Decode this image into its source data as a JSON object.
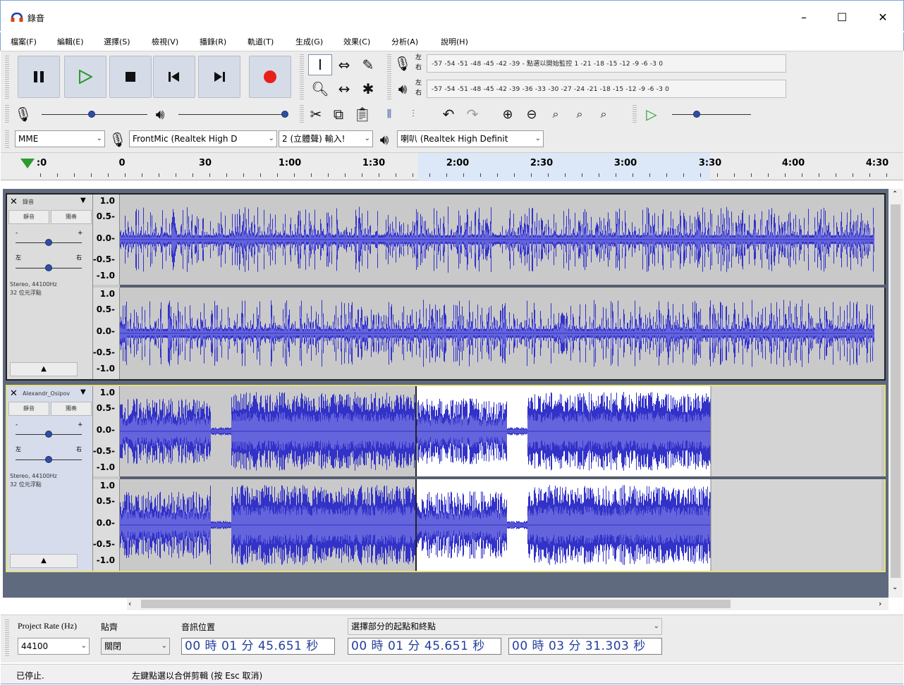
{
  "window": {
    "title": "錄音",
    "minimize": "–",
    "maximize": "☐",
    "close": "✕"
  },
  "menu": [
    "檔案(F)",
    "編輯(E)",
    "選擇(S)",
    "檢視(V)",
    "播錄(R)",
    "軌道(T)",
    "生成(G)",
    "效果(C)",
    "分析(A)",
    "說明(H)"
  ],
  "meters": {
    "record_lr": "左\n右",
    "play_lr": "左\n右",
    "record_scale": "-57 -54 -51 -48 -45 -42 -39 - 點選以開始監控 1 -21 -18 -15 -12 -9 -6 -3 0",
    "play_scale": "-57 -54 -51 -48 -45 -42 -39 -36 -33 -30 -27 -24 -21 -18 -15 -12 -9 -6 -3 0"
  },
  "devices": {
    "host": "MME",
    "mic": "FrontMic (Realtek High D",
    "channels": "2 (立體聲) 輸入!",
    "speaker": "喇叭 (Realtek High Definit"
  },
  "ruler": {
    "labels": [
      ":0",
      "0",
      "30",
      "1:00",
      "1:30",
      "2:00",
      "2:30",
      "3:00",
      "3:30",
      "4:00",
      "4:30"
    ]
  },
  "tracks": [
    {
      "name": "錄音",
      "mute": "靜音",
      "solo": "獨奏",
      "gain_minus": "-",
      "gain_plus": "+",
      "pan_left": "左",
      "pan_right": "右",
      "info": "Stereo, 44100Hz\n32 位元浮點",
      "collapse": "▲"
    },
    {
      "name": "Alexandr_Osipov",
      "mute": "靜音",
      "solo": "獨奏",
      "gain_minus": "-",
      "gain_plus": "+",
      "pan_left": "左",
      "pan_right": "右",
      "info": "Stereo, 44100Hz\n32 位元浮點",
      "collapse": "▲"
    }
  ],
  "vruler": [
    "1.0",
    "0.5-",
    "0.0-",
    "-0.5-",
    "-1.0"
  ],
  "bottom": {
    "project_rate_label": "Project Rate (Hz)",
    "snap_label": "貼齊",
    "audio_pos_label": "音訊位置",
    "selection_label": "選擇部分的起點和終點",
    "project_rate": "44100",
    "snap": "關閉",
    "audio_pos": "00 時 01 分 45.651 秒",
    "sel_start": "00 時 01 分 45.651 秒",
    "sel_end": "00 時 03 分 31.303 秒"
  },
  "status": {
    "state": "已停止.",
    "hint": "左鍵點選以合併剪輯 (按 Esc 取消)"
  },
  "colors": {
    "wave": "#3232c8",
    "wave_rms": "#6464dc",
    "selected_bg": "#ffffff",
    "track_bg": "#c9c9c9"
  }
}
